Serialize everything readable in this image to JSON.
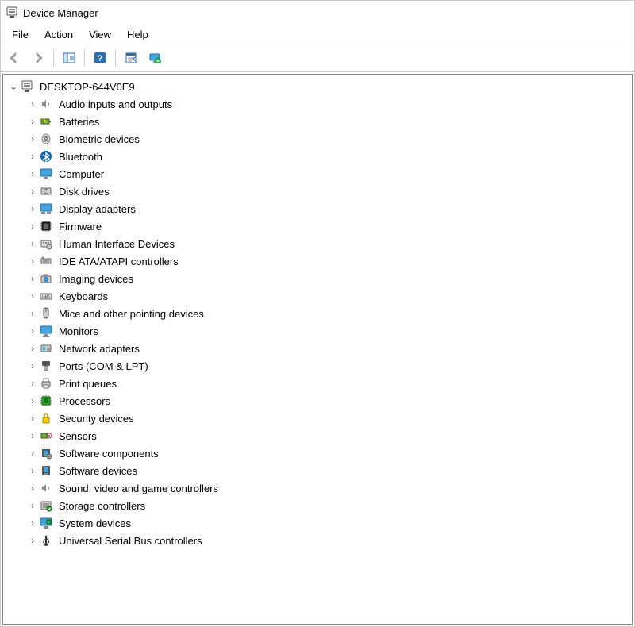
{
  "window": {
    "title": "Device Manager"
  },
  "menubar": {
    "items": [
      "File",
      "Action",
      "View",
      "Help"
    ]
  },
  "toolbar": {
    "back": "back-arrow-icon",
    "forward": "forward-arrow-icon",
    "show_hide": "show-hide-tree-icon",
    "help": "help-icon",
    "properties": "properties-icon",
    "scan": "scan-hardware-icon"
  },
  "tree": {
    "root": {
      "label": "DESKTOP-644V0E9",
      "expanded": true,
      "icon": "computer-icon"
    },
    "categories": [
      {
        "label": "Audio inputs and outputs",
        "icon": "speaker-icon"
      },
      {
        "label": "Batteries",
        "icon": "battery-icon"
      },
      {
        "label": "Biometric devices",
        "icon": "fingerprint-icon"
      },
      {
        "label": "Bluetooth",
        "icon": "bluetooth-icon"
      },
      {
        "label": "Computer",
        "icon": "monitor-icon"
      },
      {
        "label": "Disk drives",
        "icon": "disk-icon"
      },
      {
        "label": "Display adapters",
        "icon": "display-adapter-icon"
      },
      {
        "label": "Firmware",
        "icon": "chip-icon"
      },
      {
        "label": "Human Interface Devices",
        "icon": "hid-icon"
      },
      {
        "label": "IDE ATA/ATAPI controllers",
        "icon": "ide-icon"
      },
      {
        "label": "Imaging devices",
        "icon": "camera-icon"
      },
      {
        "label": "Keyboards",
        "icon": "keyboard-icon"
      },
      {
        "label": "Mice and other pointing devices",
        "icon": "mouse-icon"
      },
      {
        "label": "Monitors",
        "icon": "monitor-icon"
      },
      {
        "label": "Network adapters",
        "icon": "network-icon"
      },
      {
        "label": "Ports (COM & LPT)",
        "icon": "port-icon"
      },
      {
        "label": "Print queues",
        "icon": "printer-icon"
      },
      {
        "label": "Processors",
        "icon": "cpu-icon"
      },
      {
        "label": "Security devices",
        "icon": "security-icon"
      },
      {
        "label": "Sensors",
        "icon": "sensor-icon"
      },
      {
        "label": "Software components",
        "icon": "software-component-icon"
      },
      {
        "label": "Software devices",
        "icon": "software-device-icon"
      },
      {
        "label": "Sound, video and game controllers",
        "icon": "speaker-icon"
      },
      {
        "label": "Storage controllers",
        "icon": "storage-icon"
      },
      {
        "label": "System devices",
        "icon": "system-icon"
      },
      {
        "label": "Universal Serial Bus controllers",
        "icon": "usb-icon"
      }
    ]
  }
}
